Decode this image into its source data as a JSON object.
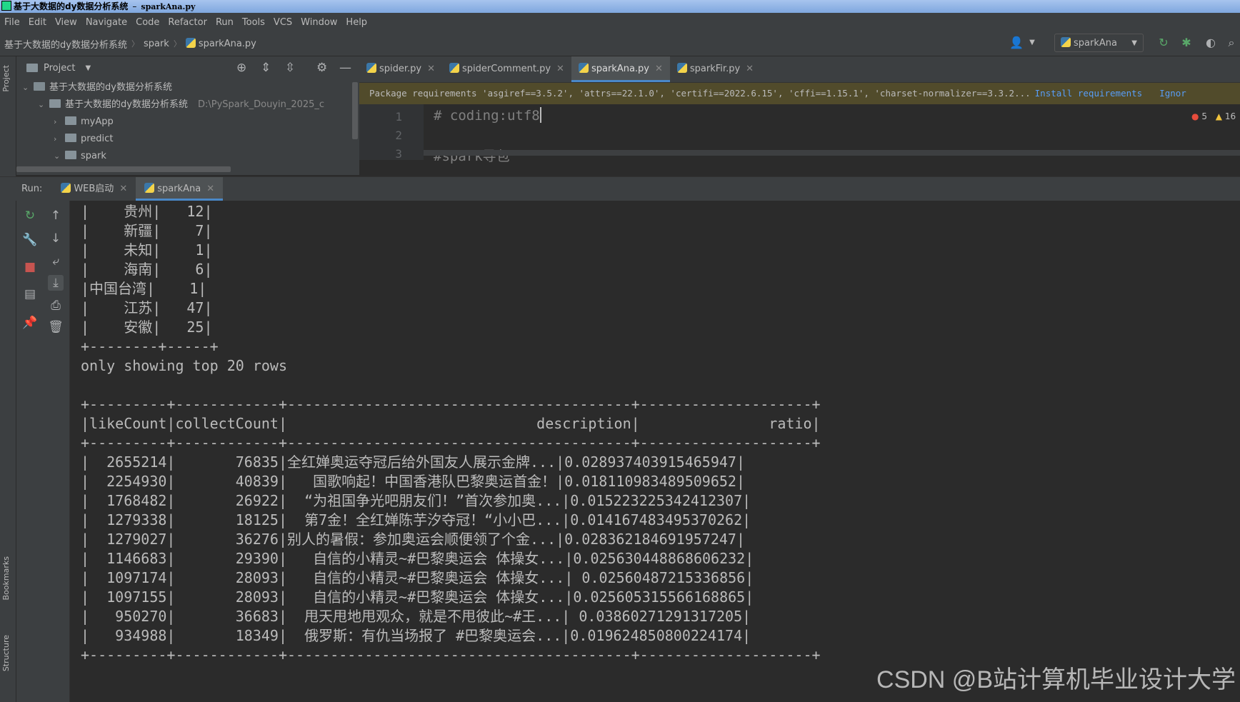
{
  "window": {
    "title": "基于大数据的dy数据分析系统",
    "file": "sparkAna.py"
  },
  "menu": [
    "File",
    "Edit",
    "View",
    "Navigate",
    "Code",
    "Refactor",
    "Run",
    "Tools",
    "VCS",
    "Window",
    "Help"
  ],
  "breadcrumb": [
    "基于大数据的dy数据分析系统",
    "spark",
    "sparkAna.py"
  ],
  "run_config": "sparkAna",
  "side_labels": {
    "project": "Project",
    "bookmarks": "Bookmarks",
    "structure": "Structure"
  },
  "project": {
    "title": "Project",
    "tree": [
      {
        "label": "基于大数据的dy数据分析系统",
        "path": ""
      },
      {
        "label": "基于大数据的dy数据分析系统",
        "path": "D:\\PySpark_Douyin_2025_c"
      },
      {
        "label": "myApp",
        "path": ""
      },
      {
        "label": "predict",
        "path": ""
      },
      {
        "label": "spark",
        "path": ""
      }
    ]
  },
  "editor": {
    "tabs": [
      "spider.py",
      "spiderComment.py",
      "sparkAna.py",
      "sparkFir.py"
    ],
    "active_tab": 2,
    "banner": "Package requirements 'asgiref==3.5.2', 'attrs==22.1.0', 'certifi==2022.6.15', 'cffi==1.15.1', 'charset-normalizer==3.3.2...",
    "banner_action_install": "Install requirements",
    "banner_action_ignore": "Ignor",
    "line_numbers": [
      "1",
      "2",
      "3"
    ],
    "line1": "# coding:utf8",
    "line3": "#spark导包",
    "errors": "5",
    "warnings": "16"
  },
  "run": {
    "label": "Run:",
    "tabs": [
      "WEB启动",
      "sparkAna"
    ],
    "active_tab": 1
  },
  "console": {
    "lines": [
      "|    贵州|   12|",
      "|    新疆|    7|",
      "|    未知|    1|",
      "|    海南|    6|",
      "|中国台湾|    1|",
      "|    江苏|   47|",
      "|    安徽|   25|",
      "+--------+-----+",
      "only showing top 20 rows",
      "",
      "+---------+------------+----------------------------------------+--------------------+",
      "|likeCount|collectCount|                             description|               ratio|",
      "+---------+------------+----------------------------------------+--------------------+",
      "|  2655214|       76835|全红婵奥运夺冠后给外国友人展示金牌...|0.028937403915465947|",
      "|  2254930|       40839|   国歌响起！中国香港队巴黎奥运首金！|0.018110983489509652|",
      "|  1768482|       26922|  “为祖国争光吧朋友们！”首次参加奥...|0.015223225342412307|",
      "|  1279338|       18125|  第7金！全红婵陈芋汐夺冠！“小小巴...|0.014167483495370262|",
      "|  1279027|       36276|别人的暑假：参加奥运会顺便领了个金...|0.028362184691957247|",
      "|  1146683|       29390|   自信的小精灵~#巴黎奥运会 体操女...|0.025630448868606232|",
      "|  1097174|       28093|   自信的小精灵~#巴黎奥运会 体操女...| 0.02560487215336856|",
      "|  1097155|       28093|   自信的小精灵~#巴黎奥运会 体操女...|0.025605315566168865|",
      "|   950270|       36683|  甩天甩地甩观众，就是不甩彼此~#王...| 0.03860271291317205|",
      "|   934988|       18349|  俄罗斯：有仇当场报了 #巴黎奥运会...|0.019624850800224174|",
      "+---------+------------+----------------------------------------+--------------------+"
    ]
  },
  "watermark": "CSDN @B站计算机毕业设计大学",
  "colors": {
    "accent": "#4a88c7",
    "banner": "#514b2b",
    "link": "#589df6"
  }
}
